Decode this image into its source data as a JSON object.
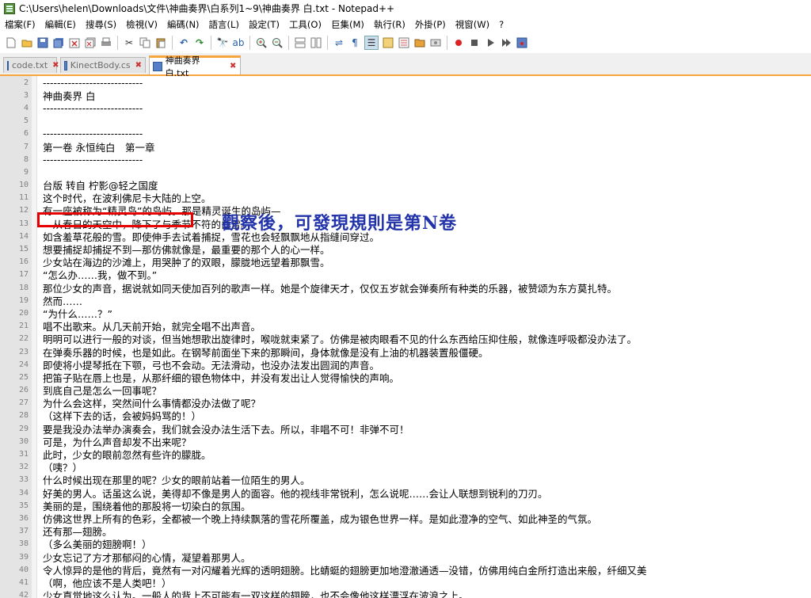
{
  "window": {
    "title": "C:\\Users\\helen\\Downloads\\文件\\神曲奏界\\白系列1~9\\神曲奏界 白.txt - Notepad++"
  },
  "menu": [
    "檔案(F)",
    "編輯(E)",
    "搜尋(S)",
    "檢視(V)",
    "編碼(N)",
    "語言(L)",
    "設定(T)",
    "工具(O)",
    "巨集(M)",
    "執行(R)",
    "外掛(P)",
    "視窗(W)",
    "?"
  ],
  "toolbar": {
    "icons": [
      "new-file-icon",
      "open-file-icon",
      "save-icon",
      "save-all-icon",
      "close-icon",
      "close-all-icon",
      "print-icon",
      "cut-icon",
      "copy-icon",
      "paste-icon",
      "undo-icon",
      "redo-icon",
      "find-icon",
      "replace-icon",
      "zoom-in-icon",
      "zoom-out-icon",
      "sync-vertical-icon",
      "sync-horizontal-icon",
      "word-wrap-icon",
      "show-all-chars-icon",
      "indent-guide-icon",
      "doc-map-icon",
      "function-list-icon",
      "folder-workspace-icon",
      "monitor-icon",
      "record-macro-icon",
      "stop-record-icon",
      "play-macro-icon",
      "play-multiple-icon",
      "save-macro-icon"
    ]
  },
  "tabs": [
    {
      "label": "code.txt",
      "active": false
    },
    {
      "label": "KinectBody.cs",
      "active": false
    },
    {
      "label": "神曲奏界 白.txt",
      "active": true
    }
  ],
  "editor": {
    "lines": [
      {
        "n": "2",
        "t": "----------------------------"
      },
      {
        "n": "3",
        "t": "神曲奏界 白"
      },
      {
        "n": "4",
        "t": "----------------------------"
      },
      {
        "n": "5",
        "t": ""
      },
      {
        "n": "6",
        "t": "----------------------------"
      },
      {
        "n": "7",
        "t": "第一卷 永恒纯白　第一章"
      },
      {
        "n": "8",
        "t": "----------------------------"
      },
      {
        "n": "9",
        "t": ""
      },
      {
        "n": "10",
        "t": "台版 转自 柠影@轻之国度"
      },
      {
        "n": "11",
        "t": "这个时代，在波利佛尼卡大陆的上空。"
      },
      {
        "n": "12",
        "t": "有一座被称为“精灵岛”的岛屿。那是精灵诞生的岛屿—"
      },
      {
        "n": "13",
        "t": "—从春日的天空中，降下了与季节不符的白雪。"
      },
      {
        "n": "14",
        "t": "如含羞草花般的雪。即使伸手去试着捕捉，雪花也会轻飘飘地从指缝间穿过。"
      },
      {
        "n": "15",
        "t": "想要捕捉却捕捉不到—那仿佛就像是，最重要的那个人的心一样。"
      },
      {
        "n": "16",
        "t": "少女站在海边的沙滩上，用哭肿了的双眼，朦胧地远望着那飘雪。"
      },
      {
        "n": "17",
        "t": "“怎么办……我，做不到。”"
      },
      {
        "n": "18",
        "t": "那位少女的声音，据说就如同天使加百列的歌声一样。她是个旋律天才，仅仅五岁就会弹奏所有种类的乐器，被赞颂为东方莫扎特。"
      },
      {
        "n": "19",
        "t": "然而……"
      },
      {
        "n": "20",
        "t": "“为什么……？”"
      },
      {
        "n": "21",
        "t": "唱不出歌来。从几天前开始，就完全唱不出声音。"
      },
      {
        "n": "22",
        "t": "明明可以进行一般的对谈，但当她想歌出旋律时，喉咙就束紧了。仿佛是被肉眼看不见的什么东西给压抑住般，就像连呼吸都没办法了。"
      },
      {
        "n": "23",
        "t": "在弹奏乐器的时候，也是如此。在钢琴前面坐下来的那瞬间，身体就像是没有上油的机器装置般僵硬。"
      },
      {
        "n": "24",
        "t": "即使将小提琴抵在下颚，弓也不会动。无法滑动，也没办法发出圆润的声音。"
      },
      {
        "n": "25",
        "t": "把笛子贴在唇上也是，从那纤细的银色物体中，并没有发出让人觉得愉快的声响。"
      },
      {
        "n": "26",
        "t": "到底自己是怎么一回事呢？"
      },
      {
        "n": "27",
        "t": "为什么会这样，突然间什么事情都没办法做了呢？"
      },
      {
        "n": "28",
        "t": "（这样下去的话，会被妈妈骂的！）"
      },
      {
        "n": "29",
        "t": "要是我没办法举办演奏会，我们就会没办法生活下去。所以，非唱不可！非弹不可！"
      },
      {
        "n": "30",
        "t": "可是，为什么声音却发不出来呢？"
      },
      {
        "n": "31",
        "t": "此时，少女的眼前忽然有些许的朦胧。"
      },
      {
        "n": "32",
        "t": "（咦？）"
      },
      {
        "n": "33",
        "t": "什么时候出现在那里的呢？少女的眼前站着一位陌生的男人。"
      },
      {
        "n": "34",
        "t": "好美的男人。话虽这么说，美得却不像是男人的面容。他的视线非常锐利，怎么说呢……会让人联想到锐利的刀刃。"
      },
      {
        "n": "35",
        "t": "美丽的是，围绕着他的那股将一切染白的氛围。"
      },
      {
        "n": "36",
        "t": "仿佛这世界上所有的色彩，全都被一个晚上持续飘落的雪花所覆盖，成为银色世界一样。是如此澄净的空气、如此神圣的气氛。"
      },
      {
        "n": "37",
        "t": "还有那—翅膀。"
      },
      {
        "n": "38",
        "t": "（多么美丽的翅膀啊！）"
      },
      {
        "n": "39",
        "t": "少女忘记了方才那郁闷的心情，凝望着那男人。"
      },
      {
        "n": "40",
        "t": "令人惊异的是他的背后，竟然有一对闪耀着光辉的透明翅膀。比蜻蜓的翅膀更加地澄澈通透—没错，仿佛用纯白金所打造出来般，纤细又美"
      },
      {
        "n": "41",
        "t": "（啊，他应该不是人类吧！）"
      },
      {
        "n": "42",
        "t": "少女直觉地这么认为。一般人的背上不可能有一双这样的翅膀，也不会像他这样漂浮在波浪之上。"
      }
    ]
  },
  "annotation": {
    "text": "觀察後，可發現規則是第N卷"
  },
  "colors": {
    "tab_accent": "#f9a53d",
    "highlight_box": "#e60000",
    "annotation": "#2233aa"
  }
}
